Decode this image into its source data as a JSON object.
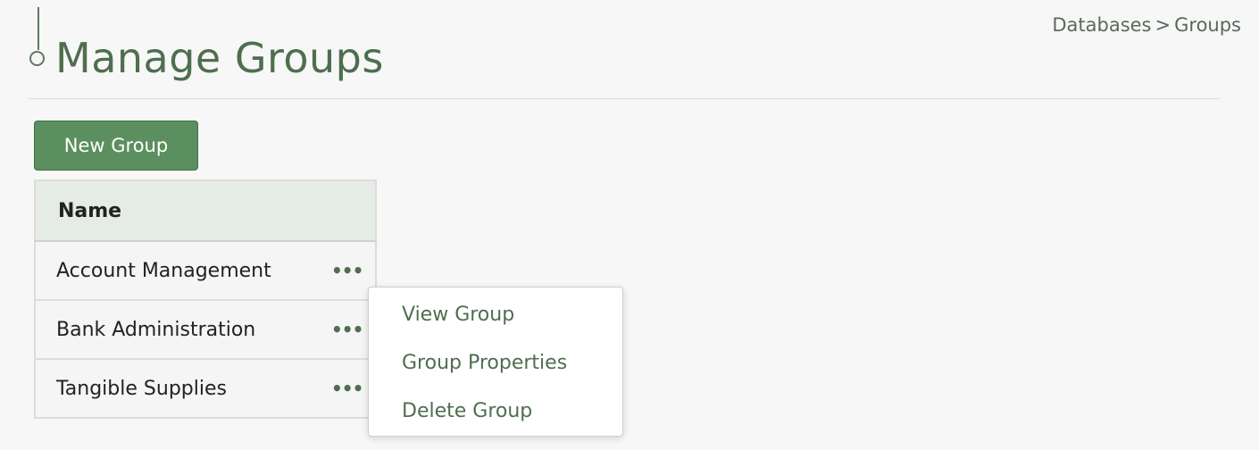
{
  "page": {
    "title": "Manage Groups"
  },
  "breadcrumb": {
    "parent": "Databases",
    "separator": ">",
    "current": "Groups"
  },
  "toolbar": {
    "new_group_label": "New Group"
  },
  "table": {
    "columns": [
      "Name"
    ],
    "rows": [
      {
        "name": "Account Management",
        "actions": "•••"
      },
      {
        "name": "Bank Administration",
        "actions": "•••"
      },
      {
        "name": "Tangible Supplies",
        "actions": "•••"
      }
    ]
  },
  "context_menu": {
    "items": [
      {
        "label": "View Group"
      },
      {
        "label": "Group Properties"
      },
      {
        "label": "Delete Group"
      }
    ]
  },
  "colors": {
    "accent": "#4f6e4f",
    "button_bg": "#5b8f5f",
    "header_bg": "#e5ebe5",
    "page_bg": "#f7f7f7"
  }
}
